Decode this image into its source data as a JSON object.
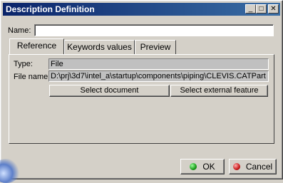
{
  "window": {
    "title": "Description Definition"
  },
  "title_buttons": {
    "minimize": "_",
    "maximize": "□",
    "close": "✕"
  },
  "name_field": {
    "label": "Name:",
    "value": ""
  },
  "tabs": [
    {
      "label": "Reference",
      "active": true
    },
    {
      "label": "Keywords values",
      "active": false
    },
    {
      "label": "Preview",
      "active": false
    }
  ],
  "reference": {
    "type_label": "Type:",
    "type_value": "File",
    "file_label": "File name:",
    "file_value": "D:\\prj\\3d7\\intel_a\\startup\\components\\piping\\CLEVIS.CATPart",
    "select_document": "Select document",
    "select_external": "Select external feature"
  },
  "footer": {
    "ok_label": "OK",
    "cancel_label": "Cancel",
    "ok_color": "#1a9a1a",
    "cancel_color": "#c81818"
  }
}
